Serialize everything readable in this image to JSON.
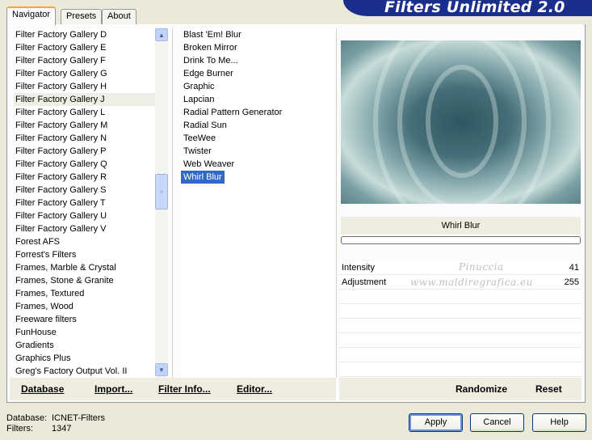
{
  "app": {
    "banner_title": "Filters Unlimited 2.0"
  },
  "tabs": [
    {
      "label": "Navigator",
      "active": true
    },
    {
      "label": "Presets",
      "active": false
    },
    {
      "label": "About",
      "active": false
    }
  ],
  "categories": [
    "Filter Factory Gallery D",
    "Filter Factory Gallery E",
    "Filter Factory Gallery F",
    "Filter Factory Gallery G",
    "Filter Factory Gallery H",
    "Filter Factory Gallery J",
    "Filter Factory Gallery L",
    "Filter Factory Gallery M",
    "Filter Factory Gallery N",
    "Filter Factory Gallery P",
    "Filter Factory Gallery Q",
    "Filter Factory Gallery R",
    "Filter Factory Gallery S",
    "Filter Factory Gallery T",
    "Filter Factory Gallery U",
    "Filter Factory Gallery V",
    "Forest AFS",
    "Forrest's Filters",
    "Frames, Marble & Crystal",
    "Frames, Stone & Granite",
    "Frames, Textured",
    "Frames, Wood",
    "Freeware filters",
    "FunHouse",
    "Gradients",
    "Graphics Plus",
    "Greg's Factory Output Vol. II"
  ],
  "selected_category": "Filter Factory Gallery J",
  "filters": [
    "Blast 'Em! Blur",
    "Broken Mirror",
    "Drink To Me...",
    "Edge Burner",
    "Graphic",
    "Lapcian",
    "Radial Pattern Generator",
    "Radial Sun",
    "TeeWee",
    "Twister",
    "Web Weaver",
    "Whirl Blur"
  ],
  "selected_filter": "Whirl Blur",
  "preview": {
    "filter_name": "Whirl Blur",
    "progress": 0
  },
  "parameters": [
    {
      "label": "Intensity",
      "value": "41"
    },
    {
      "label": "Adjustment",
      "value": "255"
    }
  ],
  "watermark": {
    "line1": "Pinuccia",
    "line2": "www.maldiregrafica.eu"
  },
  "actions": {
    "database": "Database",
    "import": "Import...",
    "filter_info": "Filter Info...",
    "editor": "Editor...",
    "randomize": "Randomize",
    "reset": "Reset"
  },
  "footer": {
    "database_label": "Database:",
    "database_value": "ICNET-Filters",
    "filters_label": "Filters:",
    "filters_value": "1347"
  },
  "buttons": {
    "apply": "Apply",
    "cancel": "Cancel",
    "help": "Help"
  },
  "colors": {
    "banner": "#1c2e8c",
    "selection": "#316ac5",
    "dialog_bg": "#ece9d8"
  }
}
